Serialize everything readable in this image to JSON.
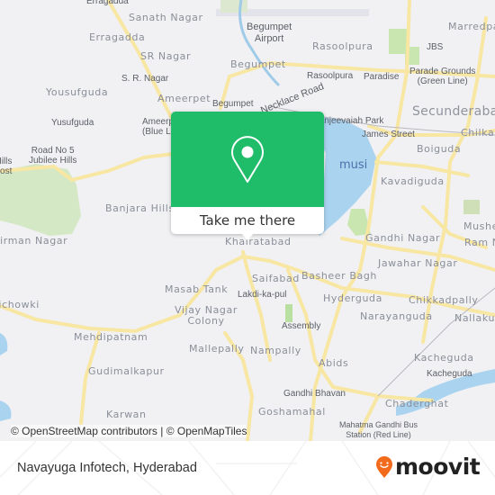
{
  "map": {
    "labels": {
      "erragadda_top": "Erragadda",
      "sanath_nagar": "Sanath Nagar",
      "begumpet_airport": "Begumpet\nAirport",
      "rasoolpura_area": "Rasoolpura",
      "jbs": "JBS",
      "marredpally": "Marredpally",
      "erragadda": "Erragadda",
      "sr_nagar": "SR Nagar",
      "begumpet_area": "Begumpet",
      "s_r_nagar_poi": "S. R. Nagar",
      "rasoolpura_poi": "Rasoolpura",
      "paradise": "Paradise",
      "parade_grounds": "Parade Grounds\n(Green Line)",
      "yousufguda": "Yousufguda",
      "ameerpet": "Ameerpet",
      "begumpet_poi": "Begumpet",
      "secunderabad": "Secunderabad",
      "yusufguda_poi": "Yusufguda",
      "ameerpet_poi": "Ameerpet\n(Blue Line)",
      "sanjeevaiah_park": "Sanjeevaiah Park",
      "james_street": "James Street",
      "chilkalguda": "Chilkalguda",
      "road_no5": "Road No 5\nJubilee Hills",
      "jubilee_checkpost": "Jubilee Hills\nCheckpost",
      "boiguda": "Boiguda",
      "musi": "musi",
      "kavadiguda": "Kavadiguda",
      "banjara_hills": "Banjara Hills",
      "musheerabad": "Musheerabad",
      "airman_nagar": "Airman Nagar",
      "gandhi_nagar": "Gandhi Nagar",
      "ram_nagar": "Ram Nagar",
      "khairatabad": "Khairatabad",
      "jawahar_nagar": "Jawahar Nagar",
      "saifabad": "Saifabad",
      "basheer_bagh": "Basheer Bagh",
      "masab_tank": "Masab Tank",
      "lakdi_ka_pul": "Lakdi-ka-pul",
      "hyderguda": "Hyderguda",
      "chikkadpally": "Chikkadpally",
      "tolichowki": "Tolichowki",
      "vijay_nagar": "Vijay Nagar\nColony",
      "narayanguda": "Narayanguda",
      "nallakunta": "Nallakunta",
      "assembly": "Assembly",
      "mehdipatnam": "Mehdipatnam",
      "mallepally": "Mallepally",
      "nampally": "Nampally",
      "abids": "Abids",
      "kacheguda_area": "Kacheguda",
      "kacheguda_poi": "Kacheguda",
      "gudimalkapur": "Gudimalkapur",
      "gandhi_bhavan": "Gandhi Bhavan",
      "chaderghat": "Chaderghat",
      "karwan": "Karwan",
      "goshamahal": "Goshamahal",
      "mgbs": "Mahatma Gandhi Bus\nStation (Red Line)",
      "necklace_road": "Necklace Road"
    },
    "popup": {
      "icon": "map-pin-icon",
      "button_label": "Take me there",
      "accent_color": "#1fbc6a"
    },
    "attribution": "© OpenStreetMap contributors | © OpenMapTiles"
  },
  "footer": {
    "place_name": "Navayuga Infotech, Hyderabad",
    "brand": "moovit",
    "brand_icon": "moovit-pin-smile-icon",
    "brand_color": "#f26b1d"
  }
}
